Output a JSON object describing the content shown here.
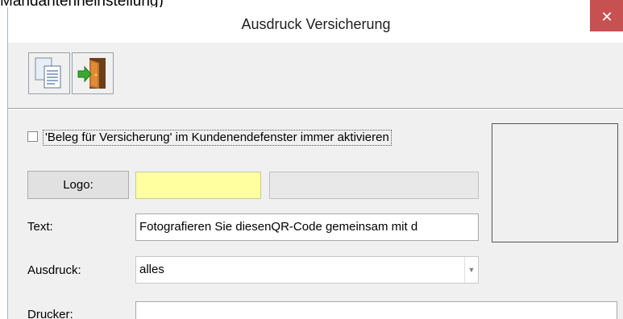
{
  "background_text": "Mandantenneinstellung)",
  "window": {
    "title": "Ausdruck Versicherung",
    "close_glyph": "✕"
  },
  "toolbar": {
    "buttons": [
      {
        "name": "copy-document",
        "icon": "documents-icon"
      },
      {
        "name": "exit",
        "icon": "exit-door-icon"
      }
    ]
  },
  "form": {
    "checkbox": {
      "label": "'Beleg für Versicherung' im Kundenendefenster immer aktivieren",
      "checked": false
    },
    "logo": {
      "button_label": "Logo:",
      "value": "",
      "path": ""
    },
    "text": {
      "label": "Text:",
      "value": "Fotografieren Sie diesenQR-Code gemeinsam mit d"
    },
    "ausdruck": {
      "label": "Ausdruck:",
      "selected": "alles"
    },
    "drucker": {
      "label": "Drucker:",
      "value": ""
    }
  },
  "colors": {
    "close_button": "#c75050",
    "logo_field": "#ffffa0",
    "panel_bg": "#f0f0f0"
  }
}
